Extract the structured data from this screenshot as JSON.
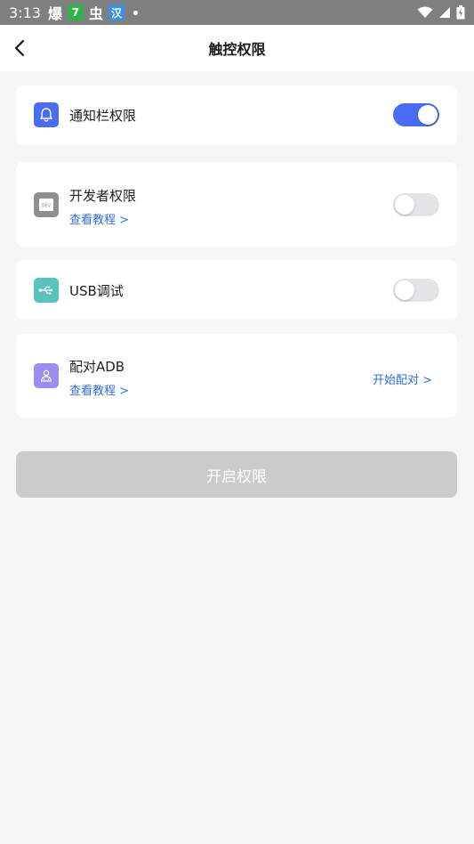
{
  "status_bar": {
    "time": "3:13",
    "notif1": "爆",
    "notif2": "7",
    "notif3": "虫",
    "notif4": "汉"
  },
  "header": {
    "title": "触控权限"
  },
  "permissions": [
    {
      "title": "通知栏权限",
      "enabled": true
    },
    {
      "title": "开发者权限",
      "tutorial": "查看教程 >",
      "enabled": false,
      "icon_text": "DEV"
    },
    {
      "title": "USB调试",
      "enabled": false
    },
    {
      "title": "配对ADB",
      "tutorial": "查看教程 >",
      "action": "开始配对 >"
    }
  ],
  "primary_button": {
    "label": "开启权限"
  },
  "colors": {
    "accent": "#4a6cf2",
    "link": "#2f6fde",
    "disabled_button": "#cbcbcb",
    "notification_icon": "#4a6cf2",
    "developer_icon": "#8f8f8f",
    "usb_icon": "#5ac3bd",
    "adb_icon": "#9a8cf0"
  },
  "icons": {
    "back": "chevron-left-icon",
    "notification": "bell-icon",
    "developer": "dev-chip-icon",
    "usb": "usb-icon",
    "adb": "person-pair-icon"
  }
}
